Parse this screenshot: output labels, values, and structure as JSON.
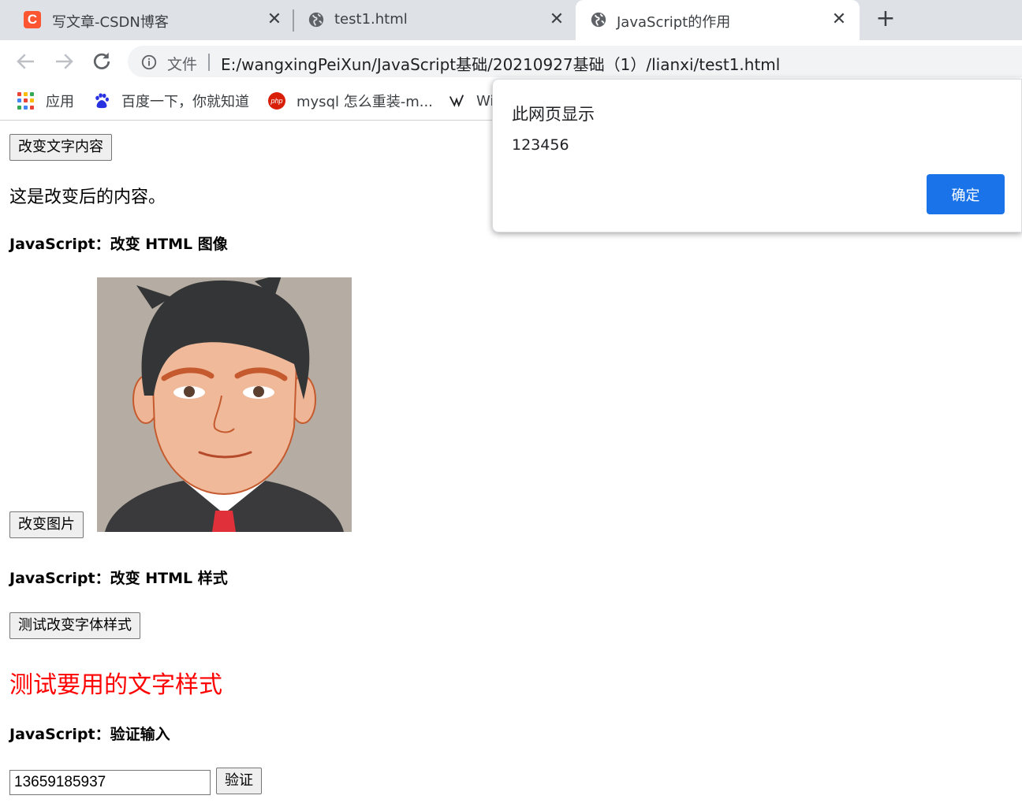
{
  "browser": {
    "tabs": [
      {
        "title": "写文章-CSDN博客",
        "icon": "csdn-icon",
        "icon_glyph": "C"
      },
      {
        "title": "test1.html",
        "icon": "globe-icon"
      },
      {
        "title": "JavaScript的作用",
        "icon": "globe-icon",
        "active": true
      }
    ],
    "close_glyph": "✕",
    "new_tab_glyph": "+",
    "address": {
      "scheme_label": "文件",
      "url": "E:/wangxingPeiXun/JavaScript基础/20210927基础（1）/lianxi/test1.html"
    },
    "bookmarks": [
      {
        "label": "应用",
        "icon": "apps-grid-icon"
      },
      {
        "label": "百度一下，你就知道",
        "icon": "baidu-paw-icon"
      },
      {
        "label": "mysql 怎么重装-m...",
        "icon": "php-icon",
        "icon_glyph": "php"
      },
      {
        "label": "Wi",
        "icon": "bookmark-icon"
      }
    ]
  },
  "page": {
    "change_text_button": "改变文字内容",
    "changed_paragraph": "这是改变后的内容。",
    "image_heading": "JavaScript：改变 HTML 图像",
    "change_image_button": "改变图片",
    "style_heading": "JavaScript：改变 HTML 样式",
    "change_style_button": "测试改变字体样式",
    "styled_text": "测试要用的文字样式",
    "styled_text_color": "#ff0000",
    "validate_heading": "JavaScript：验证输入",
    "input_value": "13659185937",
    "validate_button": "验证"
  },
  "dialog": {
    "title": "此网页显示",
    "message": "123456",
    "ok_label": "确定"
  },
  "colors": {
    "accent": "#1a73e8",
    "tabstrip": "#dee1e6",
    "csdn": "#fc5531"
  }
}
